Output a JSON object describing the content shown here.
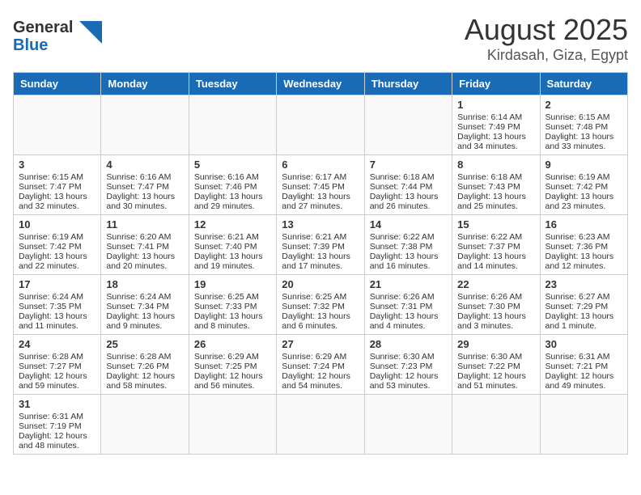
{
  "header": {
    "logo_general": "General",
    "logo_blue": "Blue",
    "title": "August 2025",
    "subtitle": "Kirdasah, Giza, Egypt"
  },
  "days_of_week": [
    "Sunday",
    "Monday",
    "Tuesday",
    "Wednesday",
    "Thursday",
    "Friday",
    "Saturday"
  ],
  "weeks": [
    [
      {
        "day": "",
        "info": ""
      },
      {
        "day": "",
        "info": ""
      },
      {
        "day": "",
        "info": ""
      },
      {
        "day": "",
        "info": ""
      },
      {
        "day": "",
        "info": ""
      },
      {
        "day": "1",
        "info": "Sunrise: 6:14 AM\nSunset: 7:49 PM\nDaylight: 13 hours and 34 minutes."
      },
      {
        "day": "2",
        "info": "Sunrise: 6:15 AM\nSunset: 7:48 PM\nDaylight: 13 hours and 33 minutes."
      }
    ],
    [
      {
        "day": "3",
        "info": "Sunrise: 6:15 AM\nSunset: 7:47 PM\nDaylight: 13 hours and 32 minutes."
      },
      {
        "day": "4",
        "info": "Sunrise: 6:16 AM\nSunset: 7:47 PM\nDaylight: 13 hours and 30 minutes."
      },
      {
        "day": "5",
        "info": "Sunrise: 6:16 AM\nSunset: 7:46 PM\nDaylight: 13 hours and 29 minutes."
      },
      {
        "day": "6",
        "info": "Sunrise: 6:17 AM\nSunset: 7:45 PM\nDaylight: 13 hours and 27 minutes."
      },
      {
        "day": "7",
        "info": "Sunrise: 6:18 AM\nSunset: 7:44 PM\nDaylight: 13 hours and 26 minutes."
      },
      {
        "day": "8",
        "info": "Sunrise: 6:18 AM\nSunset: 7:43 PM\nDaylight: 13 hours and 25 minutes."
      },
      {
        "day": "9",
        "info": "Sunrise: 6:19 AM\nSunset: 7:42 PM\nDaylight: 13 hours and 23 minutes."
      }
    ],
    [
      {
        "day": "10",
        "info": "Sunrise: 6:19 AM\nSunset: 7:42 PM\nDaylight: 13 hours and 22 minutes."
      },
      {
        "day": "11",
        "info": "Sunrise: 6:20 AM\nSunset: 7:41 PM\nDaylight: 13 hours and 20 minutes."
      },
      {
        "day": "12",
        "info": "Sunrise: 6:21 AM\nSunset: 7:40 PM\nDaylight: 13 hours and 19 minutes."
      },
      {
        "day": "13",
        "info": "Sunrise: 6:21 AM\nSunset: 7:39 PM\nDaylight: 13 hours and 17 minutes."
      },
      {
        "day": "14",
        "info": "Sunrise: 6:22 AM\nSunset: 7:38 PM\nDaylight: 13 hours and 16 minutes."
      },
      {
        "day": "15",
        "info": "Sunrise: 6:22 AM\nSunset: 7:37 PM\nDaylight: 13 hours and 14 minutes."
      },
      {
        "day": "16",
        "info": "Sunrise: 6:23 AM\nSunset: 7:36 PM\nDaylight: 13 hours and 12 minutes."
      }
    ],
    [
      {
        "day": "17",
        "info": "Sunrise: 6:24 AM\nSunset: 7:35 PM\nDaylight: 13 hours and 11 minutes."
      },
      {
        "day": "18",
        "info": "Sunrise: 6:24 AM\nSunset: 7:34 PM\nDaylight: 13 hours and 9 minutes."
      },
      {
        "day": "19",
        "info": "Sunrise: 6:25 AM\nSunset: 7:33 PM\nDaylight: 13 hours and 8 minutes."
      },
      {
        "day": "20",
        "info": "Sunrise: 6:25 AM\nSunset: 7:32 PM\nDaylight: 13 hours and 6 minutes."
      },
      {
        "day": "21",
        "info": "Sunrise: 6:26 AM\nSunset: 7:31 PM\nDaylight: 13 hours and 4 minutes."
      },
      {
        "day": "22",
        "info": "Sunrise: 6:26 AM\nSunset: 7:30 PM\nDaylight: 13 hours and 3 minutes."
      },
      {
        "day": "23",
        "info": "Sunrise: 6:27 AM\nSunset: 7:29 PM\nDaylight: 13 hours and 1 minute."
      }
    ],
    [
      {
        "day": "24",
        "info": "Sunrise: 6:28 AM\nSunset: 7:27 PM\nDaylight: 12 hours and 59 minutes."
      },
      {
        "day": "25",
        "info": "Sunrise: 6:28 AM\nSunset: 7:26 PM\nDaylight: 12 hours and 58 minutes."
      },
      {
        "day": "26",
        "info": "Sunrise: 6:29 AM\nSunset: 7:25 PM\nDaylight: 12 hours and 56 minutes."
      },
      {
        "day": "27",
        "info": "Sunrise: 6:29 AM\nSunset: 7:24 PM\nDaylight: 12 hours and 54 minutes."
      },
      {
        "day": "28",
        "info": "Sunrise: 6:30 AM\nSunset: 7:23 PM\nDaylight: 12 hours and 53 minutes."
      },
      {
        "day": "29",
        "info": "Sunrise: 6:30 AM\nSunset: 7:22 PM\nDaylight: 12 hours and 51 minutes."
      },
      {
        "day": "30",
        "info": "Sunrise: 6:31 AM\nSunset: 7:21 PM\nDaylight: 12 hours and 49 minutes."
      }
    ],
    [
      {
        "day": "31",
        "info": "Sunrise: 6:31 AM\nSunset: 7:19 PM\nDaylight: 12 hours and 48 minutes."
      },
      {
        "day": "",
        "info": ""
      },
      {
        "day": "",
        "info": ""
      },
      {
        "day": "",
        "info": ""
      },
      {
        "day": "",
        "info": ""
      },
      {
        "day": "",
        "info": ""
      },
      {
        "day": "",
        "info": ""
      }
    ]
  ]
}
